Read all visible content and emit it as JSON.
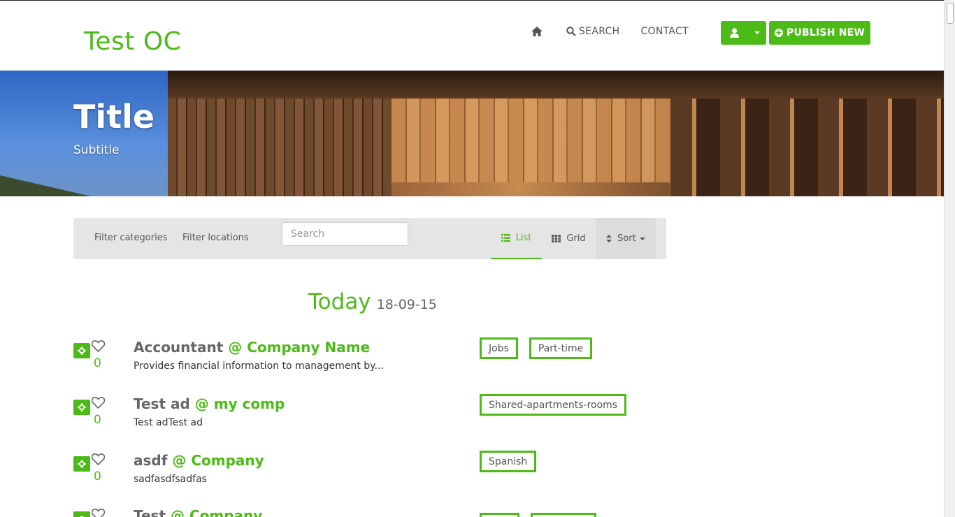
{
  "header": {
    "logo": "Test OC",
    "nav": {
      "search": "SEARCH",
      "contact": "CONTACT"
    },
    "publish_label": "PUBLISH NEW"
  },
  "hero": {
    "title": "Title",
    "subtitle": "Subtitle"
  },
  "filters": {
    "categories": "Filter categories",
    "locations": "Filter locations",
    "search_placeholder": "Search",
    "list": "List",
    "grid": "Grid",
    "sort": "Sort"
  },
  "date_heading": {
    "label": "Today",
    "date": "18-09-15"
  },
  "listings": [
    {
      "title": "Accountant",
      "company": "@ Company Name",
      "desc": "Provides financial information to management by...",
      "likes": "0",
      "tags": [
        "Jobs",
        "Part-time"
      ]
    },
    {
      "title": "Test ad",
      "company": "@ my comp",
      "desc": "Test adTest ad",
      "likes": "0",
      "tags": [
        "Shared-apartments-rooms"
      ]
    },
    {
      "title": "asdf",
      "company": "@ Company",
      "desc": "sadfasdfsadfas",
      "likes": "0",
      "tags": [
        "Spanish"
      ]
    },
    {
      "title": "Test",
      "company": "@ Company",
      "desc": "",
      "likes": "",
      "tags": [
        "",
        ""
      ]
    }
  ],
  "colors": {
    "accent": "#4cbb17",
    "filter_bar": "#e5e5e5"
  }
}
